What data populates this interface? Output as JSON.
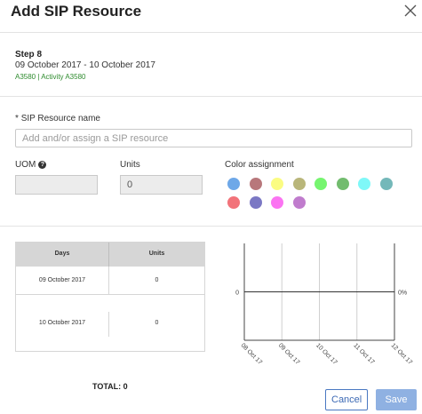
{
  "dialog": {
    "title": "Add SIP Resource"
  },
  "step": {
    "name": "Step 8",
    "dates": "09 October 2017 - 10 October 2017",
    "ids": "A3580 | Activity A3580"
  },
  "resource": {
    "label": "SIP Resource name",
    "required_mark": "*",
    "placeholder": "Add and/or assign a SIP resource",
    "value": ""
  },
  "uom": {
    "label": "UOM",
    "help_icon": "?",
    "value": ""
  },
  "units": {
    "label": "Units",
    "value": "0"
  },
  "color_assignment": {
    "label": "Color assignment",
    "swatches": [
      "#6ea8e8",
      "#b8777b",
      "#fbfc82",
      "#b9b67a",
      "#76f56f",
      "#72bc6e",
      "#7ff8f8",
      "#74b8b9",
      "#f2737a",
      "#7b78c4",
      "#fb74f2",
      "#c07ccd"
    ]
  },
  "table": {
    "headers": [
      "Days",
      "Units"
    ],
    "rows": [
      {
        "day": "09 October 2017",
        "units": "0"
      },
      {
        "day": "10 October 2017",
        "units": "0"
      }
    ]
  },
  "chart_data": {
    "type": "line",
    "x": [
      "08 Oct 17",
      "09 Oct 17",
      "10 Oct 17",
      "11 Oct 17",
      "12 Oct 17"
    ],
    "series": [
      {
        "values": [
          0,
          0,
          0,
          0,
          0
        ]
      }
    ],
    "y_left_tick": "0",
    "y_right_tick": "0%",
    "grid": true
  },
  "summary": {
    "total_label": "TOTAL: 0"
  },
  "buttons": {
    "cancel": "Cancel",
    "save": "Save"
  }
}
